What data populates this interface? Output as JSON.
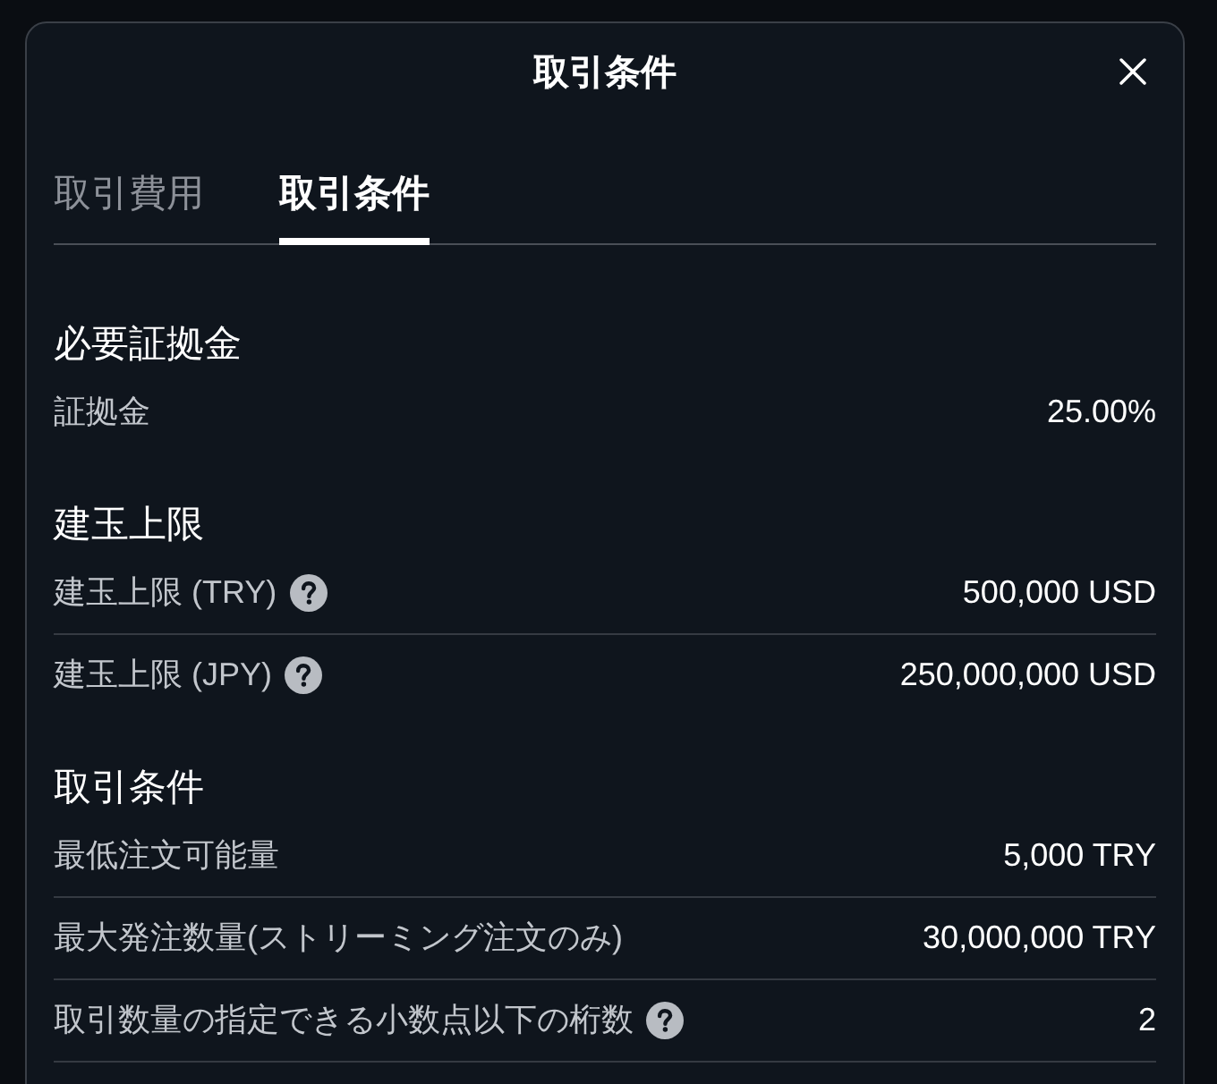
{
  "dialog": {
    "title": "取引条件"
  },
  "tabs": [
    {
      "label": "取引費用",
      "selected": false
    },
    {
      "label": "取引条件",
      "selected": true
    }
  ],
  "sections": [
    {
      "title": "必要証拠金",
      "rows": [
        {
          "label": "証拠金",
          "help": false,
          "value": "25.00%",
          "divider": false
        }
      ]
    },
    {
      "title": "建玉上限",
      "rows": [
        {
          "label": "建玉上限 (TRY)",
          "help": true,
          "value": "500,000 USD",
          "divider": true
        },
        {
          "label": "建玉上限 (JPY)",
          "help": true,
          "value": "250,000,000 USD",
          "divider": false
        }
      ]
    },
    {
      "title": "取引条件",
      "rows": [
        {
          "label": "最低注文可能量",
          "help": false,
          "value": "5,000 TRY",
          "divider": true
        },
        {
          "label": "最大発注数量(ストリーミング注文のみ)",
          "help": false,
          "value": "30,000,000 TRY",
          "divider": true
        },
        {
          "label": "取引数量の指定できる小数点以下の桁数",
          "help": true,
          "value": "2",
          "divider": true
        }
      ]
    }
  ]
}
